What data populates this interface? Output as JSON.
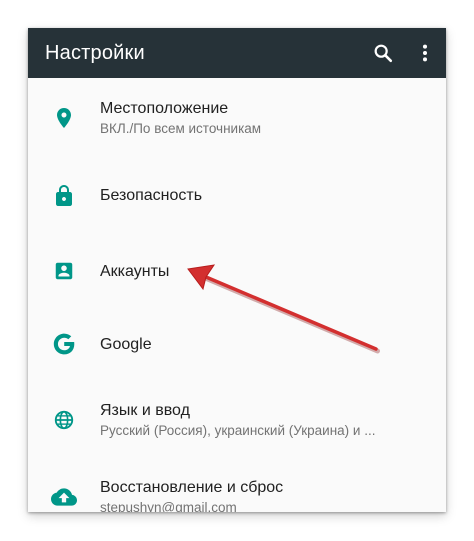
{
  "toolbar": {
    "title": "Настройки",
    "search_icon": "search-icon",
    "more_icon": "more-vert-icon"
  },
  "colors": {
    "toolbar_bg": "#263238",
    "accent": "#009688",
    "annotation_arrow": "#d32f2f"
  },
  "items": [
    {
      "icon": "location-pin-icon",
      "title": "Местоположение",
      "subtitle": "ВКЛ./По всем источникам"
    },
    {
      "icon": "lock-icon",
      "title": "Безопасность",
      "subtitle": ""
    },
    {
      "icon": "account-box-icon",
      "title": "Аккаунты",
      "subtitle": ""
    },
    {
      "icon": "google-g-icon",
      "title": "Google",
      "subtitle": ""
    },
    {
      "icon": "globe-icon",
      "title": "Язык и ввод",
      "subtitle": "Русский (Россия), украинский (Украина) и ..."
    },
    {
      "icon": "cloud-upload-icon",
      "title": "Восстановление и сброс",
      "subtitle": "stepushyn@gmail.com"
    }
  ],
  "annotation": {
    "type": "arrow",
    "points_to": "Аккаунты"
  }
}
